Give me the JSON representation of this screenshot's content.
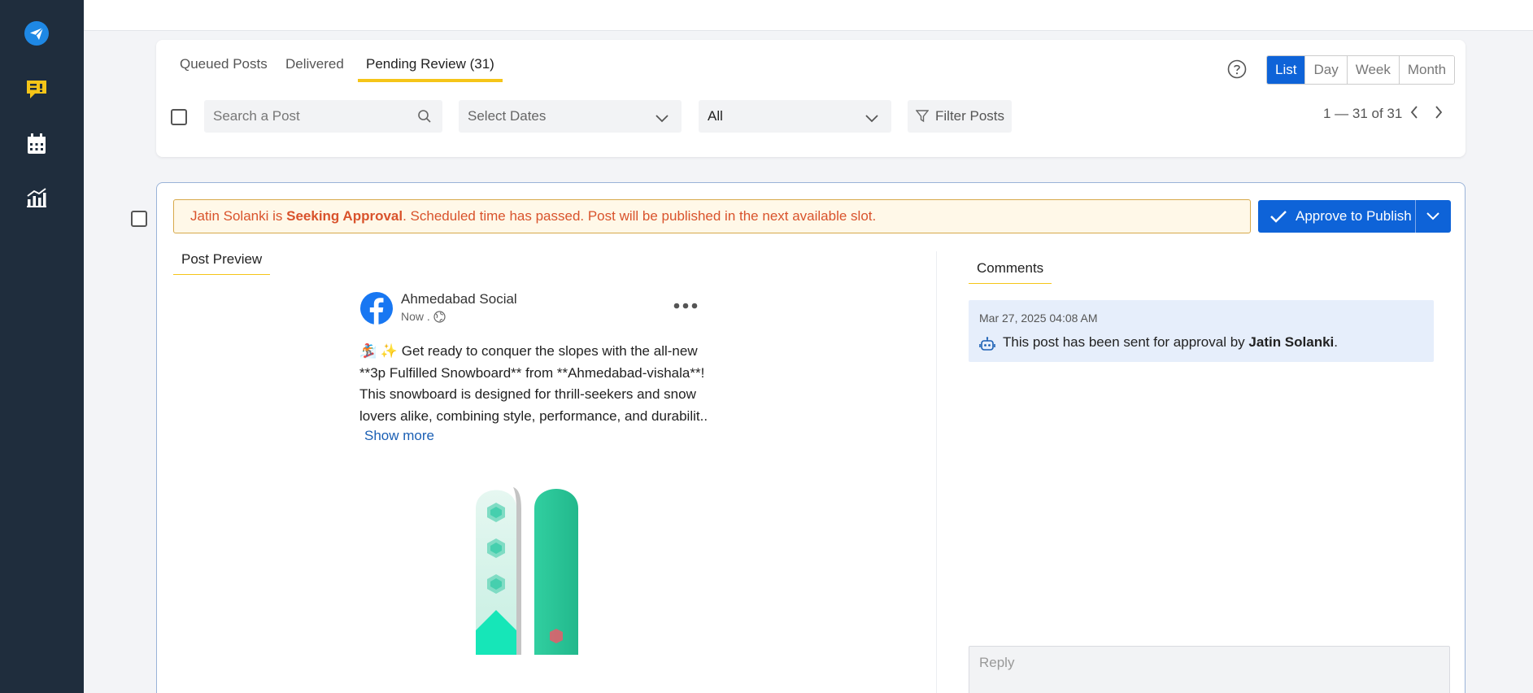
{
  "sidebar": {
    "items": [
      {
        "name": "publish",
        "icon": "paper-plane-icon"
      },
      {
        "name": "engage",
        "icon": "feedback-icon"
      },
      {
        "name": "calendar",
        "icon": "calendar-icon"
      },
      {
        "name": "analytics",
        "icon": "chart-icon"
      }
    ]
  },
  "tabs": {
    "queued": "Queued Posts",
    "delivered": "Delivered",
    "pending": "Pending Review",
    "pending_count": "(31)"
  },
  "filters": {
    "search_placeholder": "Search a Post",
    "dates_placeholder": "Select Dates",
    "type_value": "All",
    "filter_label": "Filter Posts"
  },
  "views": {
    "list": "List",
    "day": "Day",
    "week": "Week",
    "month": "Month",
    "active": "List"
  },
  "pager": {
    "text": "1 — 31 of 31"
  },
  "post": {
    "alert": {
      "name": "Jatin Solanki",
      "is": " is ",
      "status": "Seeking Approval",
      "message": ". Scheduled time has passed. Post will be published in the next available slot."
    },
    "approve_label": "Approve to Publish",
    "preview_tab": "Post Preview",
    "page_name": "Ahmedabad Social",
    "time": "Now .",
    "text_lines": [
      "🏂 ✨  Get ready to conquer the slopes with the all-new",
      "**3p Fulfilled Snowboard** from **Ahmedabad-vishala**!",
      "This snowboard is designed for thrill-seekers and snow",
      "lovers alike, combining style, performance, and durabilit.."
    ],
    "show_more": "Show more"
  },
  "comments": {
    "tab": "Comments",
    "items": [
      {
        "time": "Mar 27, 2025 04:08 AM",
        "text": "This post has been sent for approval by ",
        "author": "Jatin Solanki",
        "end": "."
      }
    ],
    "reply_placeholder": "Reply"
  },
  "colors": {
    "sidebar": "#1f2d3d",
    "accent": "#0e63d8",
    "tab_underline": "#f5c518",
    "alert_text": "#d9532c",
    "comment_bg": "#e6eefb"
  }
}
